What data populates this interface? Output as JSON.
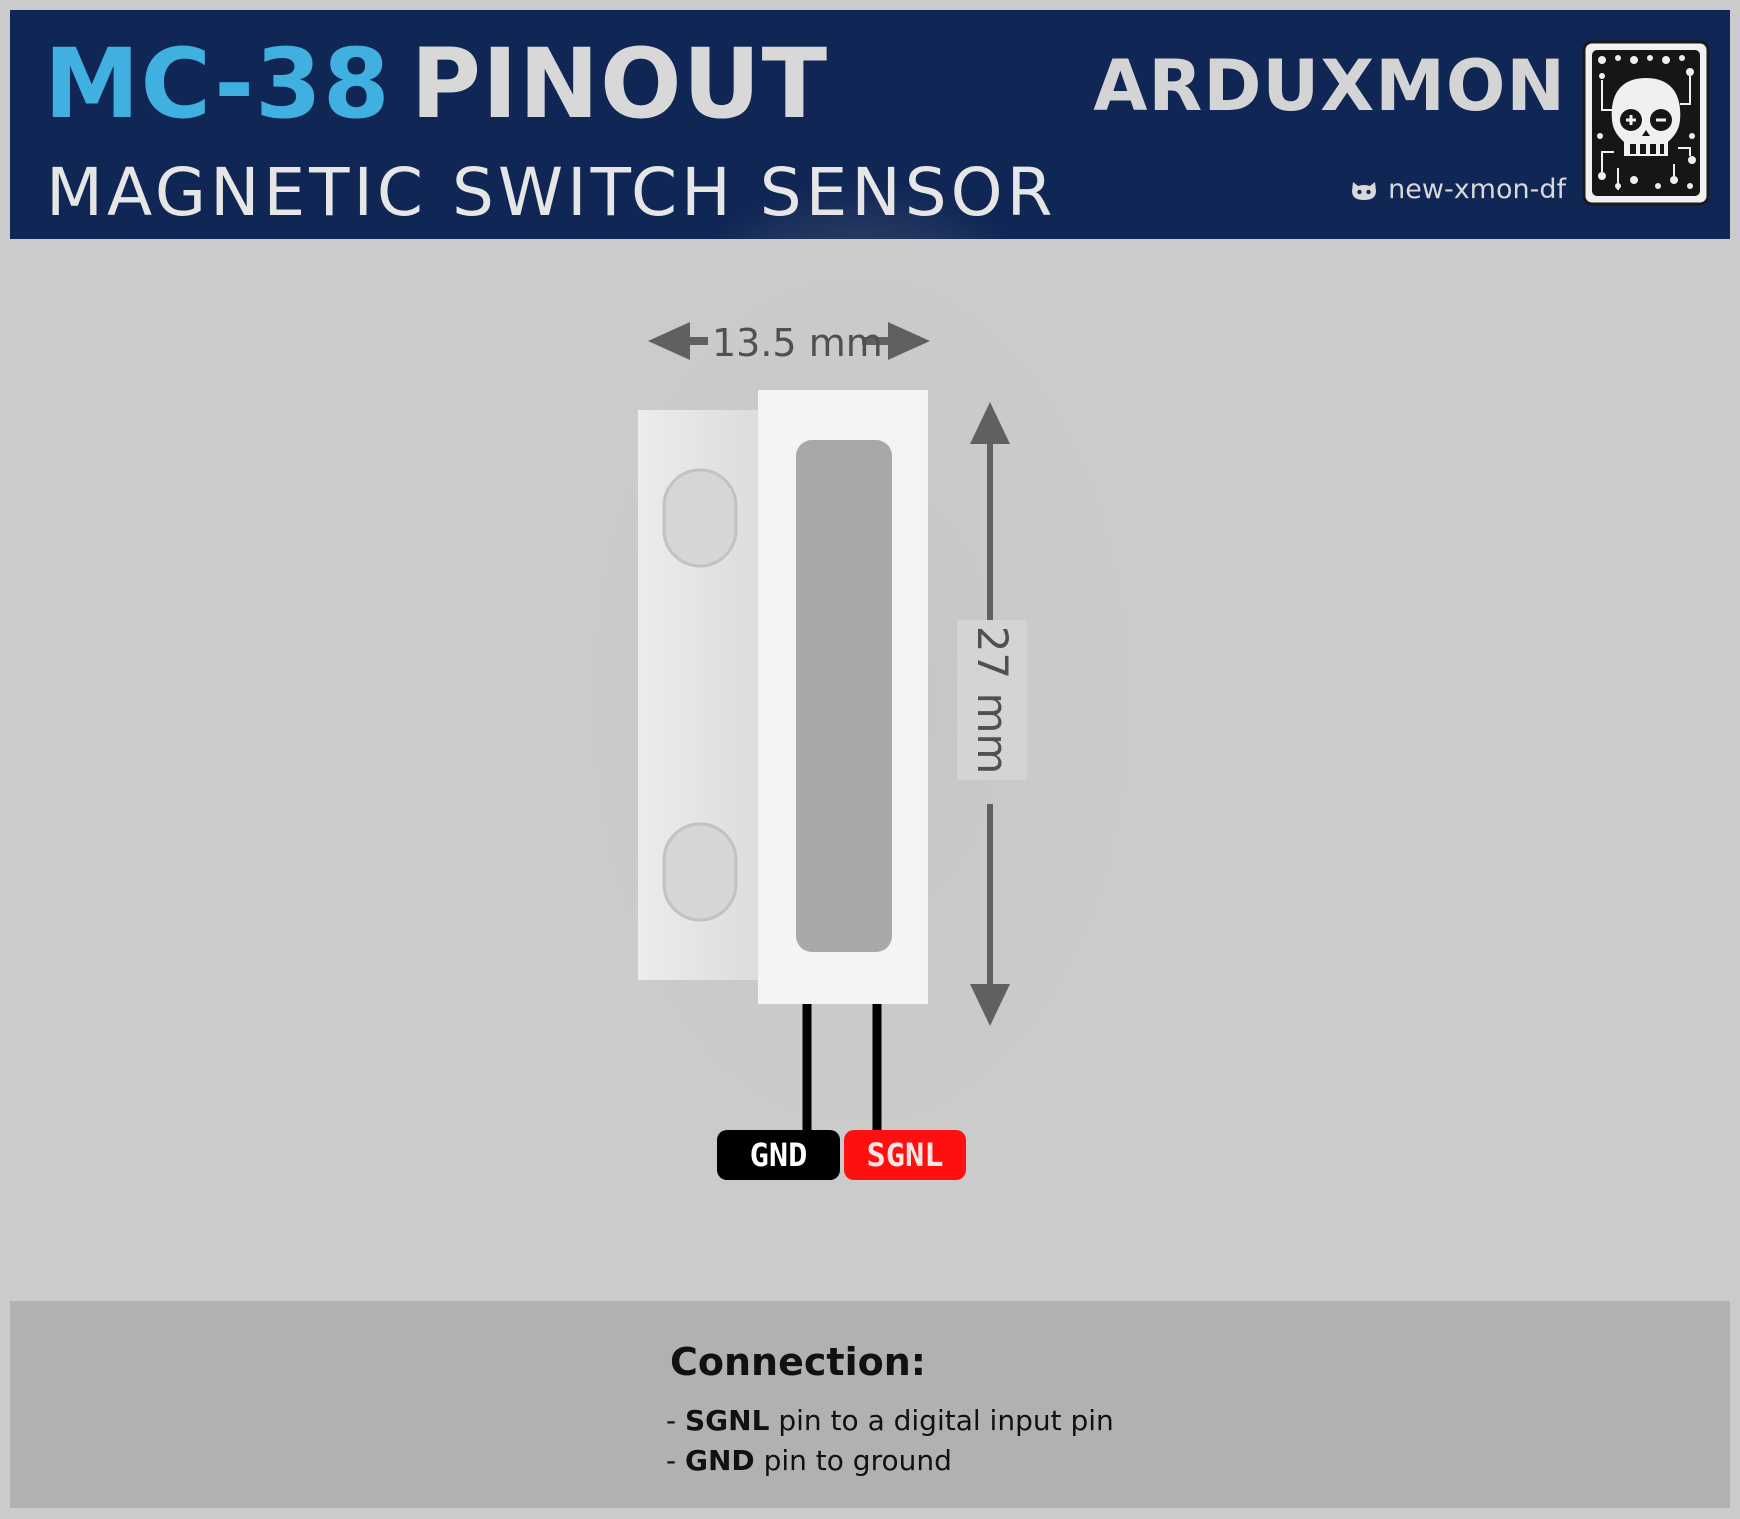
{
  "header": {
    "title_model": "MC-38",
    "title_word": "PINOUT",
    "subtitle": "MAGNETIC SWITCH SENSOR",
    "brand": "ARDUXMON",
    "handle": "new-xmon-df"
  },
  "dimensions": {
    "width": "13.5 mm",
    "height": "27 mm"
  },
  "pins": {
    "gnd": "GND",
    "sgnl": "SGNL"
  },
  "connection": {
    "title": "Connection:",
    "lines": [
      {
        "prefix": "- ",
        "pin": "SGNL",
        "text": " pin to a digital input pin"
      },
      {
        "prefix": "- ",
        "pin": "GND",
        "text": " pin to ground"
      }
    ]
  },
  "colors": {
    "header_bg": "#102654",
    "model_accent": "#40b0e0",
    "sgnl_red": "#ff1010",
    "page_bg": "#cbcbcb",
    "panel_bg": "#b1b1b1"
  }
}
